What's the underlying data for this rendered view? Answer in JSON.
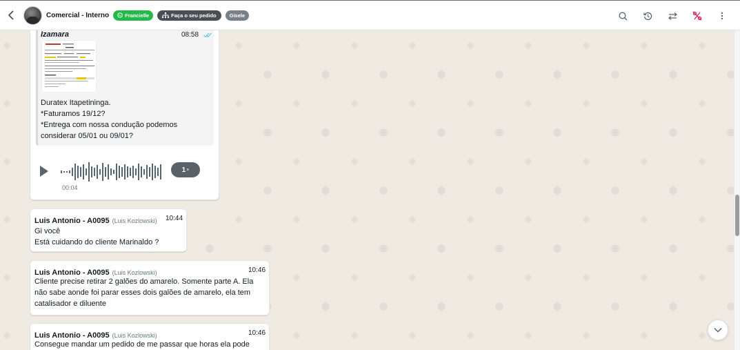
{
  "header": {
    "title": "Comercial - Interno",
    "tags": [
      {
        "label": "Francielle",
        "color": "#25b94a",
        "icon": "whatsapp-icon"
      },
      {
        "label": "Faça o seu pedido",
        "color": "#4a4f55",
        "icon": "sitemap-icon"
      },
      {
        "label": "Gisele",
        "color": "#7b8087"
      }
    ],
    "icons": [
      "search-icon",
      "history-icon",
      "transfer-icon",
      "percent-off-icon",
      "more-vert-icon"
    ]
  },
  "messages": {
    "quoted": {
      "sender": "Izamara",
      "time": "08:58",
      "lines": [
        "Duratex Itapetininga.",
        "*Faturamos 19/12?",
        "*Entrega com nossa condução podemos",
        "considerar 05/01 ou 09/01?"
      ]
    },
    "voice": {
      "speed": "1",
      "speed_suffix": "×",
      "duration": "00:04"
    },
    "m1": {
      "sender": "Luis Antonio - A0095",
      "sub": "(Luis Kozlowski)",
      "time": "10:44",
      "lines": [
        "Gi você",
        "Está cuidando do cliente Marinaldo ?"
      ]
    },
    "m2": {
      "sender": "Luis Antonio - A0095",
      "sub": "(Luis Kozlowski)",
      "time": "10:46",
      "lines": [
        "Cliente precise retirar 2 galões do amarelo. Somente parte A. Ela",
        "não sabe aonde foi parar esses dois galões de amarelo, ela tem",
        "catalisador e diluente"
      ]
    },
    "m3": {
      "sender": "Luis Antonio - A0095",
      "sub": "(Luis Kozlowski)",
      "time": "10:46",
      "lines": [
        "Consegue mandar um pedido de me passar que horas ela pode"
      ]
    }
  },
  "colors": {
    "chat_bg": "#efeae2",
    "read_ticks": "#53bdeb",
    "tag_green": "#25b94a",
    "tag_dark": "#4a4f55",
    "tag_gray": "#7b8087",
    "percent_icon": "#e0245e"
  }
}
